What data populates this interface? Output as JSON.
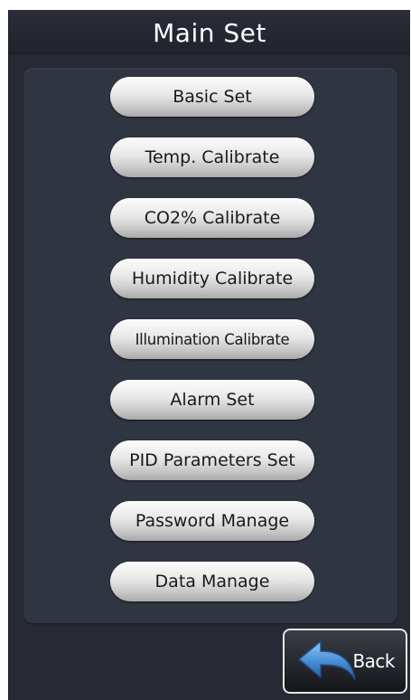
{
  "header": {
    "title": "Main Set"
  },
  "menu": {
    "items": [
      {
        "label": "Basic Set"
      },
      {
        "label": "Temp. Calibrate"
      },
      {
        "label": "CO2% Calibrate"
      },
      {
        "label": "Humidity Calibrate"
      },
      {
        "label": "Illumination Calibrate"
      },
      {
        "label": "Alarm Set"
      },
      {
        "label": "PID Parameters Set"
      },
      {
        "label": "Password Manage"
      },
      {
        "label": "Data Manage"
      }
    ]
  },
  "footer": {
    "back_label": "Back",
    "back_icon": "back-arrow-icon"
  },
  "colors": {
    "background": "#272a35",
    "panel": "#303542",
    "button_light": "#fbfbfb",
    "button_dark": "#a9a9a9",
    "arrow": "#4a90d9"
  }
}
